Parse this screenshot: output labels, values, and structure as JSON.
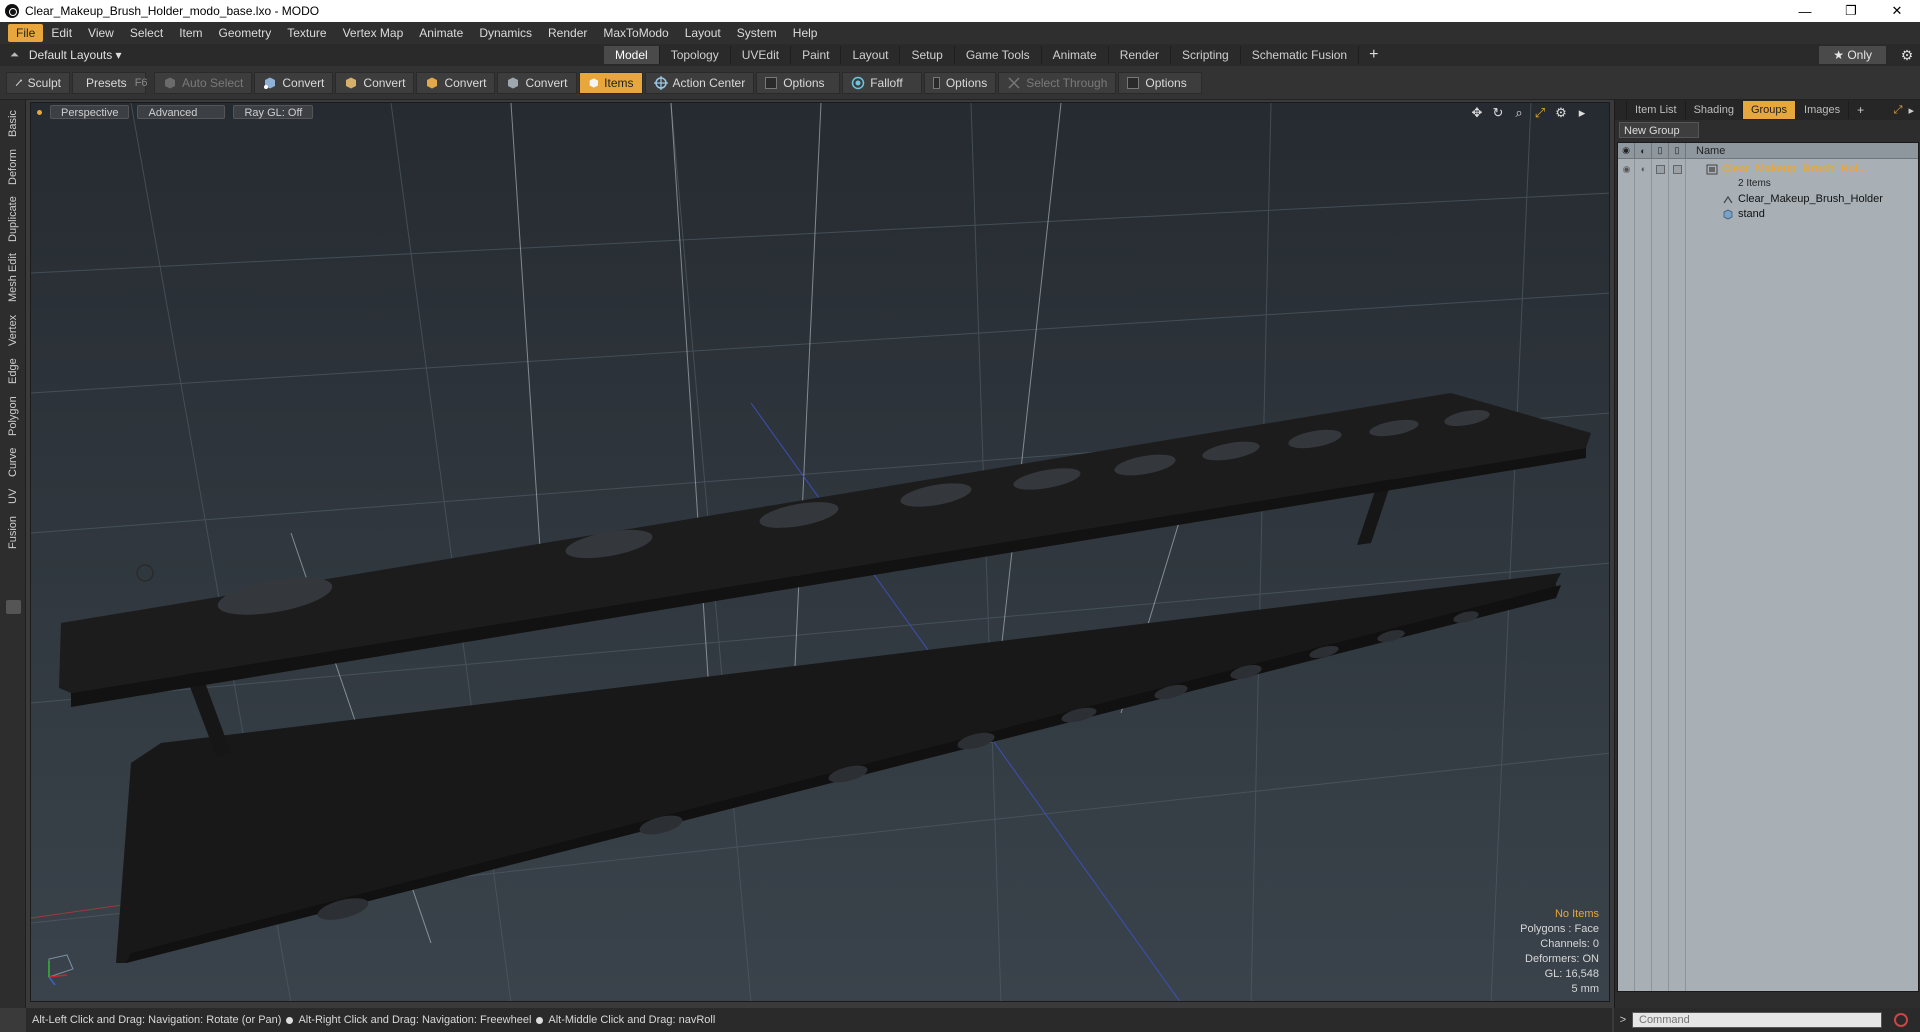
{
  "window": {
    "title": "Clear_Makeup_Brush_Holder_modo_base.lxo - MODO",
    "minimize": "—",
    "maximize": "❐",
    "close": "✕"
  },
  "menu": [
    "File",
    "Edit",
    "View",
    "Select",
    "Item",
    "Geometry",
    "Texture",
    "Vertex Map",
    "Animate",
    "Dynamics",
    "Render",
    "MaxToModo",
    "Layout",
    "System",
    "Help"
  ],
  "layout": {
    "selector": "Default Layouts ▾",
    "tabs": [
      "Model",
      "Topology",
      "UVEdit",
      "Paint",
      "Layout",
      "Setup",
      "Game Tools",
      "Animate",
      "Render",
      "Scripting",
      "Schematic Fusion"
    ],
    "active_tab": "Model",
    "only": "★  Only"
  },
  "toolbar": {
    "sculpt": "Sculpt",
    "presets": "Presets",
    "presets_key": "F6",
    "auto_select": "Auto Select",
    "convert1": "Convert",
    "convert2": "Convert",
    "convert3": "Convert",
    "convert4": "Convert",
    "items": "Items",
    "action_center": "Action Center",
    "options1": "Options",
    "falloff": "Falloff",
    "options2": "Options",
    "select_through": "Select Through",
    "options3": "Options"
  },
  "left_tabs": [
    "Basic",
    "Deform",
    "Duplicate",
    "Mesh Edit",
    "Vertex",
    "Edge",
    "Polygon",
    "Curve",
    "UV",
    "Fusion"
  ],
  "viewport": {
    "perspective": "Perspective",
    "advanced": "Advanced",
    "raygl": "Ray GL: Off",
    "info": {
      "no_items": "No Items",
      "polygons": "Polygons : Face",
      "channels": "Channels: 0",
      "deformers": "Deformers: ON",
      "gl": "GL: 16,548",
      "unit": "5 mm"
    }
  },
  "status": {
    "hint1": "Alt-Left Click and Drag: Navigation: Rotate (or Pan)",
    "hint2": "Alt-Right Click and Drag: Navigation: Freewheel",
    "hint3": "Alt-Middle Click and Drag: navRoll"
  },
  "right_panel": {
    "tabs": [
      "Item List",
      "Shading",
      "Groups",
      "Images"
    ],
    "active_tab": "Groups",
    "new_group": "New Group",
    "name_header": "Name",
    "group_name": "Clear_Makeup_Brush_Hol...",
    "group_count": "2 Items",
    "items": [
      "Clear_Makeup_Brush_Holder",
      "stand"
    ]
  },
  "command": {
    "prompt": ">",
    "placeholder": "Command"
  },
  "colors": {
    "accent": "#e8a73c",
    "viewport_top": "#262b31",
    "viewport_bottom": "#3a434b"
  }
}
